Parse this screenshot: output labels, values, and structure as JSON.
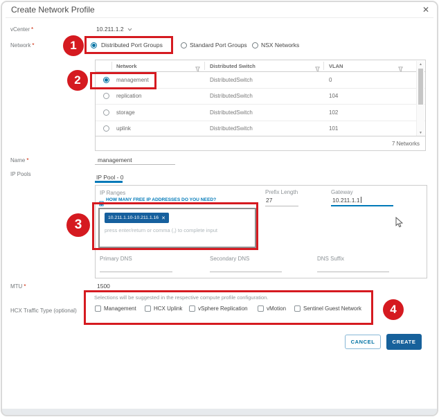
{
  "ui": {
    "title": "Create Network Profile",
    "required_mark": "*",
    "icons": {
      "close": "✕",
      "chip_remove": "✕",
      "scroll_up": "▲",
      "scroll_down": "▼"
    },
    "buttons": {
      "cancel": "CANCEL",
      "create": "CREATE"
    }
  },
  "vcenter": {
    "label": "vCenter",
    "value": "10.211.1.2"
  },
  "network": {
    "label": "Network",
    "options": [
      {
        "label": "Distributed Port Groups",
        "selected": true
      },
      {
        "label": "Standard Port Groups",
        "selected": false
      },
      {
        "label": "NSX Networks",
        "selected": false
      }
    ]
  },
  "network_table": {
    "columns": [
      "Network",
      "Distributed Switch",
      "VLAN"
    ],
    "rows": [
      {
        "network": "management",
        "switch": "DistributedSwitch",
        "vlan": "0",
        "selected": true
      },
      {
        "network": "replication",
        "switch": "DistributedSwitch",
        "vlan": "104",
        "selected": false
      },
      {
        "network": "storage",
        "switch": "DistributedSwitch",
        "vlan": "102",
        "selected": false
      },
      {
        "network": "uplink",
        "switch": "DistributedSwitch",
        "vlan": "101",
        "selected": false
      }
    ],
    "footer": "7 Networks"
  },
  "name_field": {
    "label": "Name",
    "value": "management"
  },
  "ip_pools": {
    "label": "IP Pools",
    "tab": "IP Pool - 0",
    "ip_ranges": {
      "label": "IP Ranges",
      "helper_link": "HOW MANY FREE IP ADDRESSES DO YOU NEED?",
      "chip": "10.211.1.10-10.211.1.16",
      "placeholder": "press enter/return or comma (,) to complete input"
    },
    "prefix_length": {
      "label": "Prefix Length",
      "value": "27"
    },
    "gateway": {
      "label": "Gateway",
      "value": "10.211.1.1"
    },
    "primary_dns": {
      "label": "Primary DNS",
      "value": ""
    },
    "secondary_dns": {
      "label": "Secondary DNS",
      "value": ""
    },
    "dns_suffix": {
      "label": "DNS Suffix",
      "value": ""
    }
  },
  "mtu": {
    "label": "MTU",
    "value": "1500"
  },
  "hcx_traffic": {
    "label": "HCX Traffic Type (optional)",
    "description": "Selections will be suggested in the respective compute profile configuration.",
    "options": [
      {
        "label": "Management",
        "checked": false
      },
      {
        "label": "HCX Uplink",
        "checked": false
      },
      {
        "label": "vSphere Replication",
        "checked": false
      },
      {
        "label": "vMotion",
        "checked": false
      },
      {
        "label": "Sentinel Guest Network",
        "checked": false
      }
    ]
  },
  "annotations": {
    "markers": [
      "1",
      "2",
      "3",
      "4"
    ]
  },
  "colors": {
    "accent_blue": "#0079b8",
    "primary_button_blue": "#17619b",
    "annotation_red": "#d51a20"
  }
}
